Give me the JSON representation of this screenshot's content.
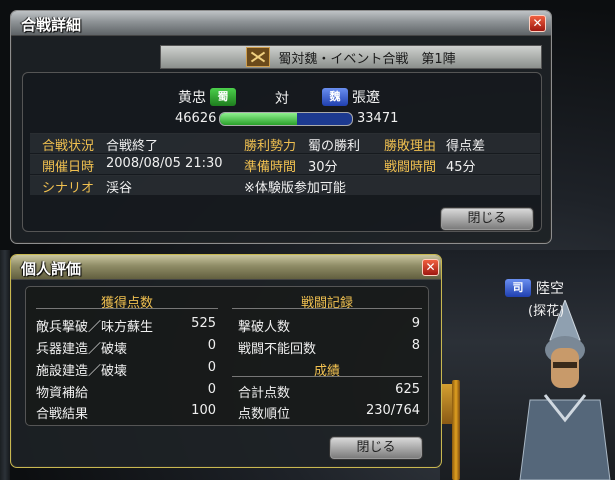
{
  "detail": {
    "title": "合戦詳細",
    "battle_name": "蜀対魏・イベント合戦　第1陣",
    "left_general": "黄忠",
    "left_force_label": "蜀",
    "vs": "対",
    "right_force_label": "魏",
    "right_general": "張遼",
    "left_score": "46626",
    "right_score": "33471",
    "score_share": 0.582,
    "rows": [
      [
        {
          "label": "合戦状況",
          "value": "合戦終了"
        },
        {
          "label": "勝利勢力",
          "value": "蜀の勝利"
        },
        {
          "label": "勝敗理由",
          "value": "得点差"
        }
      ],
      [
        {
          "label": "開催日時",
          "value": "2008/08/05 21:30"
        },
        {
          "label": "準備時間",
          "value": "30分"
        },
        {
          "label": "戦闘時間",
          "value": "45分"
        }
      ],
      [
        {
          "label": "シナリオ",
          "value": "渓谷"
        },
        {
          "label": "",
          "value": "※体験版参加可能"
        },
        {
          "label": "",
          "value": ""
        }
      ]
    ],
    "close_label": "閉じる"
  },
  "personal": {
    "title": "個人評価",
    "left_header": "獲得点数",
    "right_header": "戦闘記録",
    "result_header": "成績",
    "left_stats": [
      {
        "k": "敵兵撃破／味方蘇生",
        "v": "525"
      },
      {
        "k": "兵器建造／破壊",
        "v": "0"
      },
      {
        "k": "施設建造／破壊",
        "v": "0"
      },
      {
        "k": "物資補給",
        "v": "0"
      },
      {
        "k": "合戦結果",
        "v": "100"
      }
    ],
    "right_stats": [
      {
        "k": "撃破人数",
        "v": "9"
      },
      {
        "k": "戦闘不能回数",
        "v": "8"
      }
    ],
    "result_stats": [
      {
        "k": "合計点数",
        "v": "625"
      },
      {
        "k": "点数順位",
        "v": "230/764"
      }
    ],
    "close_label": "閉じる"
  },
  "npc": {
    "force_label": "司",
    "name": "陸空",
    "role": "(探花)"
  },
  "colors": {
    "label_gold": "#f0c050",
    "shu_green": "#2aa02a",
    "wei_blue": "#2040b0"
  }
}
